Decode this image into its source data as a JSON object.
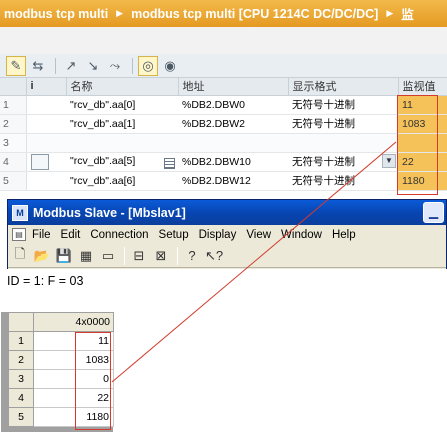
{
  "tia": {
    "breadcrumb": [
      "modbus tcp multi",
      "modbus tcp multi [CPU 1214C DC/DC/DC]",
      "监"
    ],
    "columns": [
      "i",
      "名称",
      "地址",
      "显示格式",
      "监视值"
    ],
    "rows": [
      {
        "num": "1",
        "name": "\"rcv_db\".aa[0]",
        "address": "%DB2.DBW0",
        "format": "无符号十进制",
        "value": "11"
      },
      {
        "num": "2",
        "name": "\"rcv_db\".aa[1]",
        "address": "%DB2.DBW2",
        "format": "无符号十进制",
        "value": "1083"
      },
      {
        "num": "3",
        "name": "",
        "address": "",
        "format": "",
        "value": ""
      },
      {
        "num": "4",
        "name": "\"rcv_db\".aa[5]",
        "address": "%DB2.DBW10",
        "format": "无符号十进制",
        "value": "22"
      },
      {
        "num": "5",
        "name": "\"rcv_db\".aa[6]",
        "address": "%DB2.DBW12",
        "format": "无符号十进制",
        "value": "1180"
      }
    ]
  },
  "modbus": {
    "title": "Modbus Slave - [Mbslav1]",
    "menu": [
      "File",
      "Edit",
      "Connection",
      "Setup",
      "Display",
      "View",
      "Window",
      "Help"
    ],
    "status": "ID = 1: F = 03",
    "column_header": "4x0000",
    "rows": [
      {
        "num": "1",
        "value": "11"
      },
      {
        "num": "2",
        "value": "1083"
      },
      {
        "num": "3",
        "value": "0"
      },
      {
        "num": "4",
        "value": "22"
      },
      {
        "num": "5",
        "value": "1180"
      }
    ]
  },
  "colors": {
    "tia_header": "#e49a22",
    "monitor_cell": "#f5c25a",
    "highlight": "#d23b2e",
    "xp_title": "#0a5bd8"
  }
}
